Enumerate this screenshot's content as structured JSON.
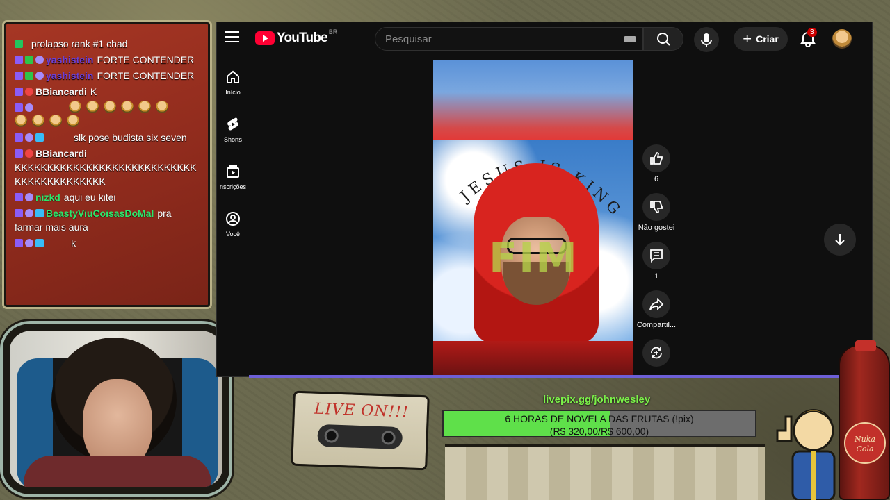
{
  "chat": {
    "messages": [
      {
        "user": "",
        "text": "prolapso rank #1 chad",
        "color": "red"
      },
      {
        "user": "yashistein",
        "text": "FORTE CONTENDER",
        "color": "purple"
      },
      {
        "user": "yashistein",
        "text": "FORTE CONTENDER",
        "color": "purple"
      },
      {
        "user": "BBiancardi",
        "text": "K",
        "color": "white"
      },
      {
        "user": "",
        "text": "",
        "color": "red",
        "emotes": 10
      },
      {
        "user": "",
        "text": "slk pose budista six seven",
        "color": "red"
      },
      {
        "user": "BBiancardi",
        "text": "KKKKKKKKKKKKKKKKKKKKKKKKKKKKKKKKKKKKKKKKKK",
        "color": "white"
      },
      {
        "user": "nizkd",
        "text": "aqui eu kitei",
        "color": "green"
      },
      {
        "user": "BeastyViuCoisasDoMal",
        "text": "pra farmar mais aura",
        "color": "green"
      },
      {
        "user": "",
        "text": "k",
        "color": "red"
      }
    ]
  },
  "youtube": {
    "logo_text": "YouTube",
    "region": "BR",
    "search_placeholder": "Pesquisar",
    "create_label": "Criar",
    "notification_count": "3",
    "nav": [
      {
        "label": "Início"
      },
      {
        "label": "Shorts"
      },
      {
        "label": "nscrições"
      },
      {
        "label": "Você"
      }
    ],
    "video": {
      "arc_text": "JESUS IS KING",
      "overlay_text": "FIM"
    },
    "actions": {
      "like_count": "6",
      "dislike_label": "Não gostei",
      "comment_count": "1",
      "share_label": "Compartil..."
    }
  },
  "overlay": {
    "cassette_text": "LIVE ON!!!",
    "donation_url": "livepix.gg/johnwesley",
    "goal_line1": "6 HORAS DE NOVELA DAS FRUTAS (!pix)",
    "goal_line2": "(R$ 320,00/R$ 600,00)",
    "goal_current": 320,
    "goal_target": 600,
    "bottle_text": "Nuka Cola"
  },
  "colors": {
    "accent_red": "#ff0033",
    "goal_green": "#5fe04a",
    "chat_bg": "#a63624"
  }
}
